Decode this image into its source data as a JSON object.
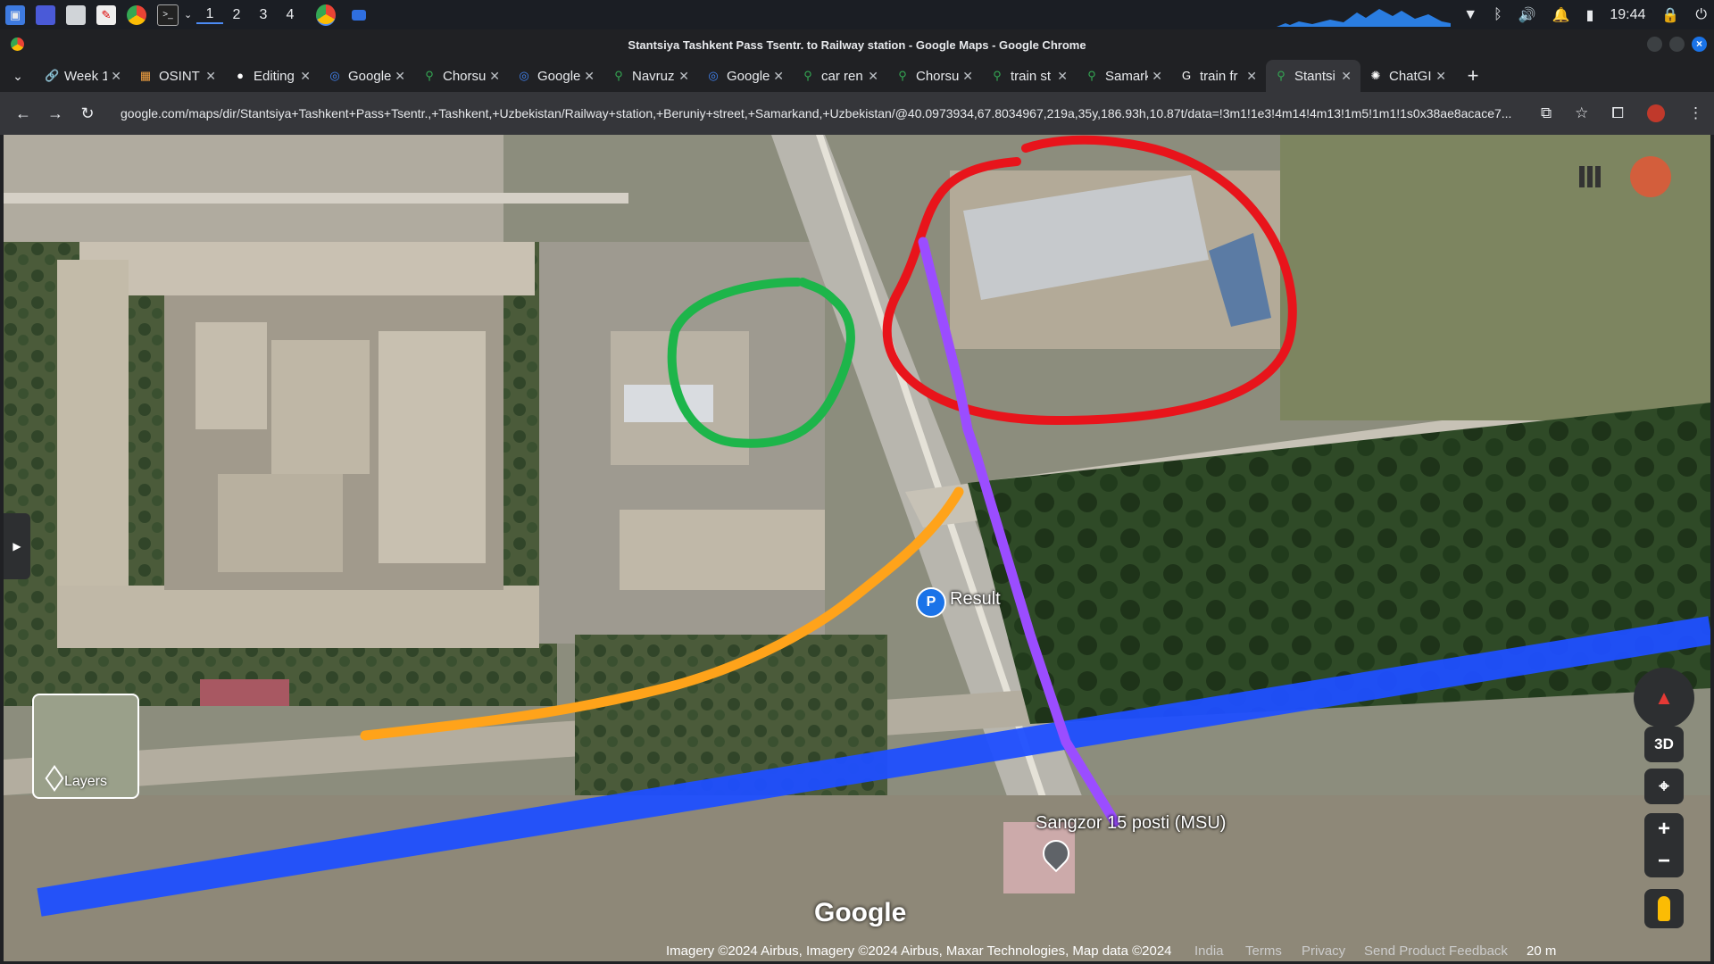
{
  "taskbar": {
    "workspaces": [
      "1",
      "2",
      "3",
      "4"
    ],
    "clock": "19:44"
  },
  "window": {
    "title": "Stantsiya Tashkent Pass Tsentr. to Railway station - Google Maps - Google Chrome"
  },
  "tabs": [
    {
      "label": "Week 1",
      "icon": "link-icon"
    },
    {
      "label": "OSINT",
      "icon": "osint-icon"
    },
    {
      "label": "Editing",
      "icon": "github-icon"
    },
    {
      "label": "Google",
      "icon": "google-lens-icon"
    },
    {
      "label": "Chorsu",
      "icon": "maps-pin-icon"
    },
    {
      "label": "Google",
      "icon": "google-lens-icon"
    },
    {
      "label": "Navruz",
      "icon": "maps-pin-icon"
    },
    {
      "label": "Google",
      "icon": "google-lens-icon"
    },
    {
      "label": "car ren",
      "icon": "maps-pin-icon"
    },
    {
      "label": "Chorsu",
      "icon": "maps-pin-icon"
    },
    {
      "label": "train st",
      "icon": "maps-pin-icon"
    },
    {
      "label": "Samark",
      "icon": "maps-pin-icon"
    },
    {
      "label": "train fr",
      "icon": "google-icon"
    },
    {
      "label": "Stantsi",
      "icon": "maps-pin-icon",
      "active": true
    },
    {
      "label": "ChatGI",
      "icon": "chatgpt-icon"
    }
  ],
  "address": {
    "url": "google.com/maps/dir/Stantsiya+Tashkent+Pass+Tsentr.,+Tashkent,+Uzbekistan/Railway+station,+Beruniy+street,+Samarkand,+Uzbekistan/@40.0973934,67.8034967,219a,35y,186.93h,10.87t/data=!3m1!1e3!4m14!4m13!1m5!1m1!1s0x38ae8acace7..."
  },
  "map": {
    "result_label": "Result",
    "place_label": "Sangzor 15 posti (MSU)",
    "watermark": "Google",
    "layers_label": "Layers",
    "control_3d": "3D",
    "zoom_in": "+",
    "zoom_out": "−",
    "annotation_colors": {
      "red": "#e8141b",
      "green": "#1db54a",
      "purple": "#9b4dff",
      "orange": "#ffa31a",
      "route": "#1f4fff"
    }
  },
  "attribution": {
    "imagery": "Imagery ©2024 Airbus, Imagery ©2024 Airbus, Maxar Technologies, Map data ©2024",
    "region": "India",
    "terms": "Terms",
    "privacy": "Privacy",
    "feedback": "Send Product Feedback",
    "scale": "20 m"
  }
}
